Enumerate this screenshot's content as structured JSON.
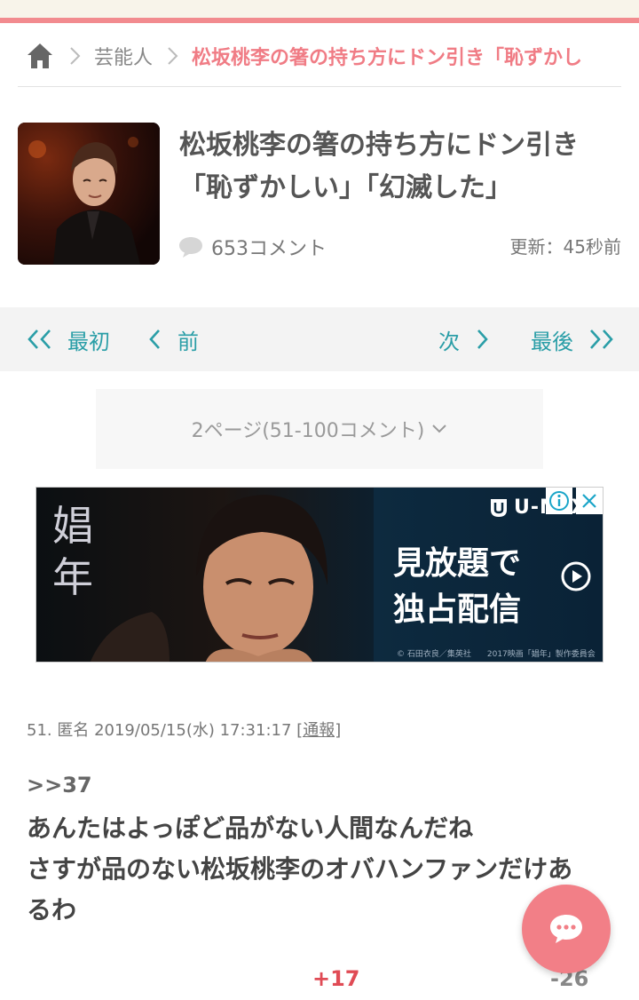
{
  "breadcrumb": {
    "category": "芸能人",
    "current": "松坂桃李の箸の持ち方にドン引き「恥ずかし"
  },
  "article": {
    "title_line1": "松坂桃李の箸の持ち方にドン引き",
    "title_line2": "「恥ずかしい」「幻滅した」",
    "comments": "653コメント",
    "updated": "更新：45秒前"
  },
  "pager": {
    "first": "最初",
    "prev": "前",
    "next": "次",
    "last": "最後",
    "accent": "#2a9ea7"
  },
  "page_select": {
    "label": "2ページ(51-100コメント)"
  },
  "ad": {
    "brand": "U-NEXT",
    "headline_line1": "見放題で",
    "headline_line2": "独占配信",
    "kanji": "娼年",
    "credit": "© 石田衣良／集英社　　2017映画「娼年」製作委員会"
  },
  "comment": {
    "meta": "51. 匿名 2019/05/15(水) 17:31:17",
    "report": "[通報]",
    "ref": ">>37",
    "line1": "あんたはよっぽど品がない人間なんだね",
    "line2": "さすが品のない松坂桃李のオバハンファンだけあ",
    "line3": "るわ",
    "plus": "+17",
    "minus": "-26"
  },
  "colors": {
    "brand_pink": "#f28b8f",
    "plus": "#e04b55"
  }
}
